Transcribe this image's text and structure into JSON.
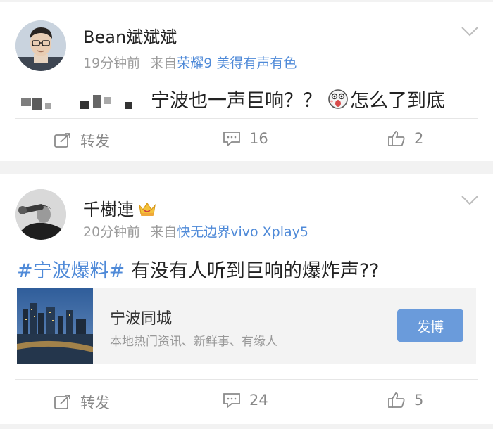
{
  "posts": [
    {
      "user": "Bean斌斌斌",
      "time": "19分钟前",
      "from_prefix": "来自",
      "source": "荣耀9 美得有声有色",
      "text_tail": "宁波也一声巨响？？",
      "text_end": "怎么了到底",
      "emoji_icon": "scared-face-emoji",
      "actions": {
        "repost": "转发",
        "comments": "16",
        "likes": "2"
      }
    },
    {
      "user": "千樹連",
      "time": "20分钟前",
      "from_prefix": "来自",
      "source": "快无边界vivo Xplay5",
      "hashtag": "#宁波爆料#",
      "text": " 有没有人听到巨响的爆炸声??",
      "badge_icon": "vip-crown-icon",
      "share_card": {
        "title": "宁波同城",
        "subtitle": "本地热门资讯、新鲜事、有缘人",
        "button": "发博"
      },
      "actions": {
        "repost": "转发",
        "comments": "24",
        "likes": "5"
      }
    }
  ],
  "colors": {
    "link": "#4f8ad8",
    "button": "#6a9bdb",
    "meta": "#9b9b9b"
  }
}
